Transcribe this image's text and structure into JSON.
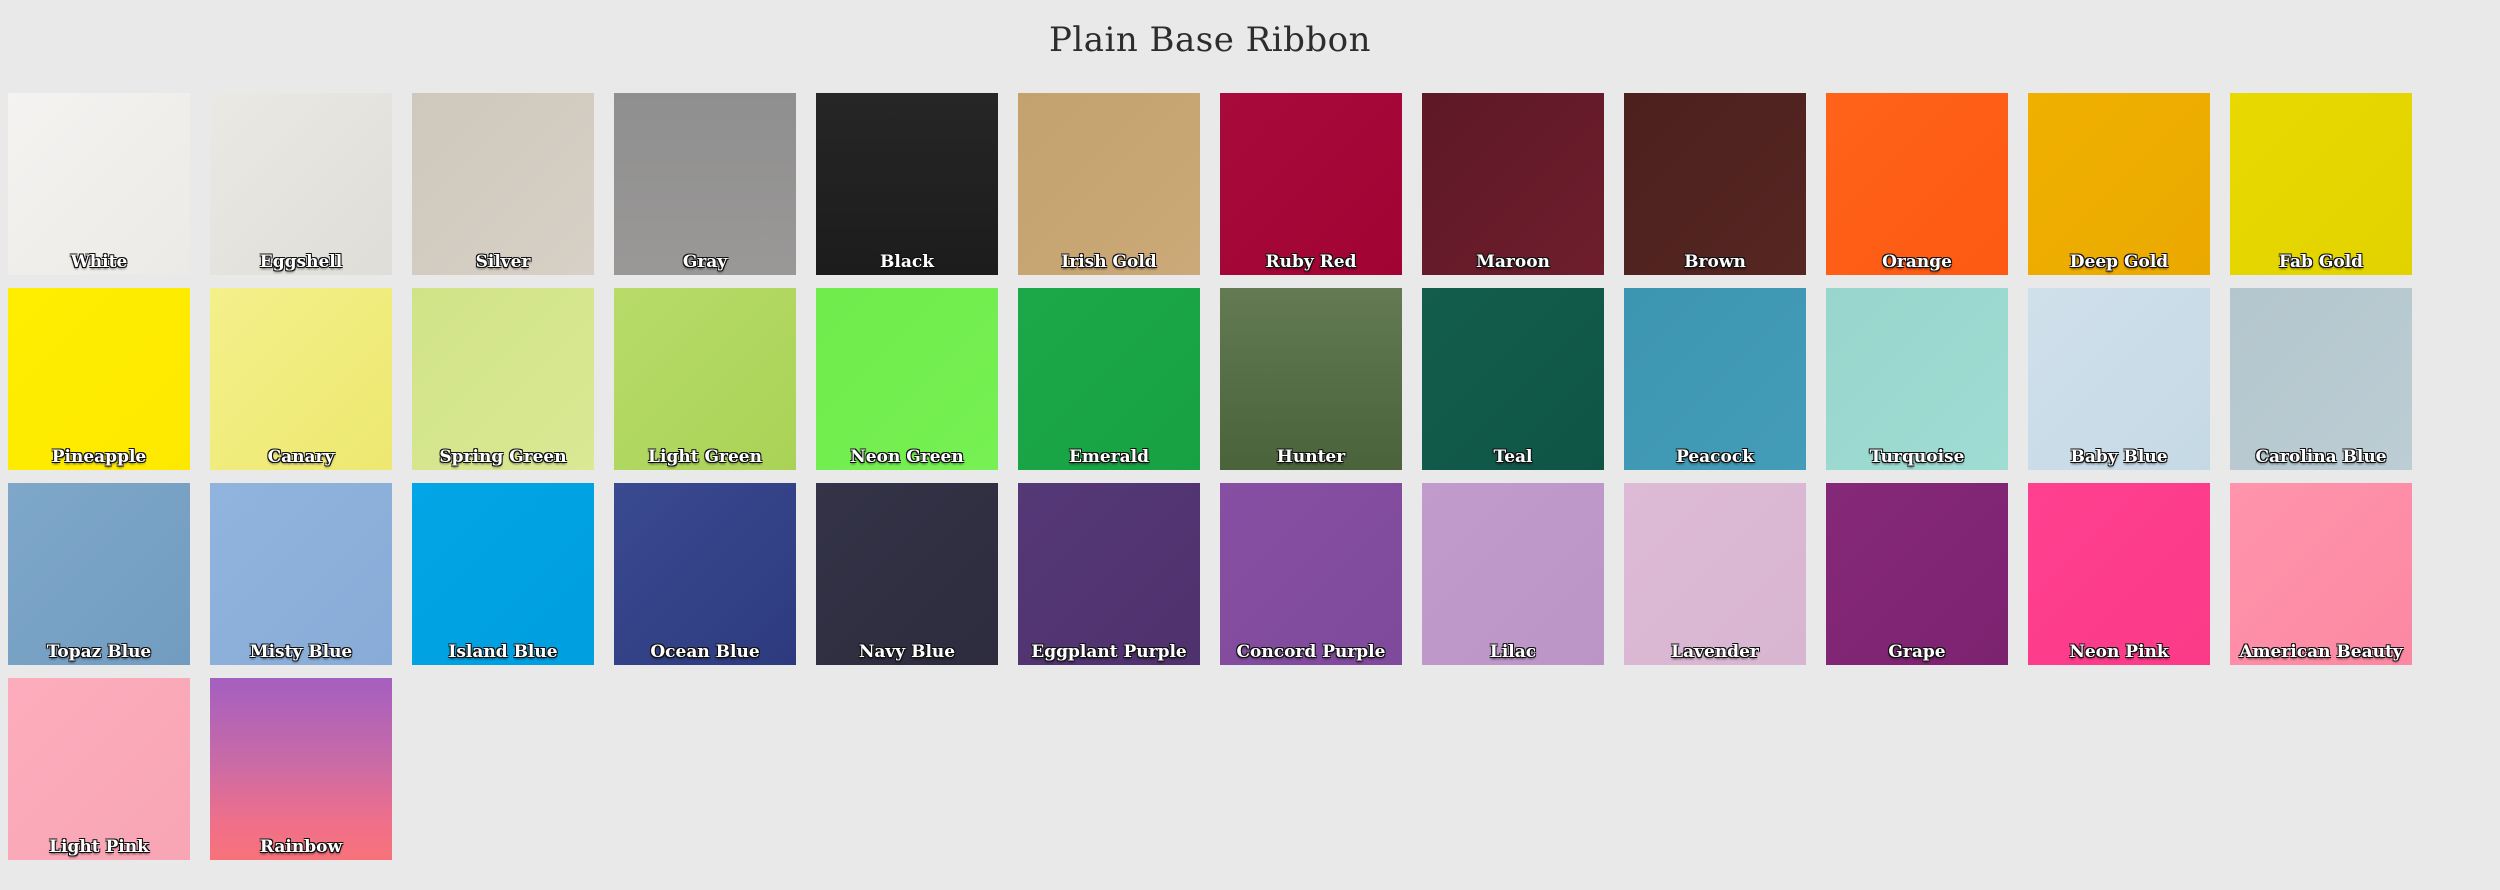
{
  "page": {
    "title": "Plain Base Ribbon"
  },
  "swatches": [
    {
      "label": "White",
      "color": "#f0efec",
      "gradient": "linear-gradient(135deg, #f4f3f1 0%, #eceae6 100%)"
    },
    {
      "label": "Eggshell",
      "color": "#e6e4df",
      "gradient": "linear-gradient(135deg, #ebe9e4 0%, #dfddd7 100%)"
    },
    {
      "label": "Silver",
      "color": "#d2cbbf",
      "gradient": "linear-gradient(135deg, #cfc8bc 0%, #d6d0c6 100%)"
    },
    {
      "label": "Gray",
      "color": "#959494",
      "gradient": "linear-gradient(180deg, #8f8f8f 0%, #9a9897 100%)"
    },
    {
      "label": "Black",
      "color": "#222222",
      "gradient": "linear-gradient(180deg, #262626 0%, #1c1c1c 100%)"
    },
    {
      "label": "Irish Gold",
      "color": "#c7a673",
      "gradient": "linear-gradient(135deg, #c4a26e 0%, #cba978 100%)"
    },
    {
      "label": "Ruby Red",
      "color": "#a70638",
      "gradient": "linear-gradient(135deg, #a80a3c 0%, #a10333 100%)"
    },
    {
      "label": "Maroon",
      "color": "#681c2a",
      "gradient": "linear-gradient(135deg, #5e1826 0%, #6e1e2d 100%)"
    },
    {
      "label": "Brown",
      "color": "#512220",
      "gradient": "linear-gradient(135deg, #4c201e 0%, #562622 100%)"
    },
    {
      "label": "Orange",
      "color": "#ff5e16",
      "gradient": "linear-gradient(135deg, #ff6318 0%, #fd5914 100%)"
    },
    {
      "label": "Deep Gold",
      "color": "#eeae00",
      "gradient": "linear-gradient(135deg, #f0b000 0%, #eba900 100%)"
    },
    {
      "label": "Fab Gold",
      "color": "#e5d700",
      "gradient": "linear-gradient(135deg, #e8d900 0%, #e2d300 100%)"
    },
    {
      "label": "Pineapple",
      "color": "#ffec00",
      "gradient": "linear-gradient(135deg, #ffee00 0%, #fde900 100%)"
    },
    {
      "label": "Canary",
      "color": "#f2ee7c",
      "gradient": "linear-gradient(135deg, #f4f08a 0%, #ede870 100%)"
    },
    {
      "label": "Spring Green",
      "color": "#d5e68c",
      "gradient": "linear-gradient(135deg, #d1e387 0%, #d9e994 100%)"
    },
    {
      "label": "Light Green",
      "color": "#b1d85f",
      "gradient": "linear-gradient(135deg, #b8db69 0%, #a9d356 100%)"
    },
    {
      "label": "Neon Green",
      "color": "#72ee4f",
      "gradient": "linear-gradient(135deg, #70ec4d 0%, #76f052 100%)"
    },
    {
      "label": "Emerald",
      "color": "#1aa546",
      "gradient": "linear-gradient(135deg, #1ca848 0%, #17a143 100%)"
    },
    {
      "label": "Hunter",
      "color": "#566f45",
      "gradient": "linear-gradient(180deg, #637a53 0%, #4a633b 100%)"
    },
    {
      "label": "Teal",
      "color": "#11594a",
      "gradient": "linear-gradient(135deg, #135d4c 0%, #0f5546 100%)"
    },
    {
      "label": "Peacock",
      "color": "#3f98b4",
      "gradient": "linear-gradient(135deg, #3c95b1 0%, #439cb8 100%)"
    },
    {
      "label": "Turquoise",
      "color": "#9ad8cf",
      "gradient": "linear-gradient(135deg, #98d6cd 0%, #9fdcd3 100%)"
    },
    {
      "label": "Baby Blue",
      "color": "#cbdde8",
      "gradient": "linear-gradient(135deg, #d0e0eb 0%, #c5d9e5 100%)"
    },
    {
      "label": "Carolina Blue",
      "color": "#b7c8cf",
      "gradient": "linear-gradient(135deg, #b4c6cd 0%, #bccdd4 100%)"
    },
    {
      "label": "Topaz Blue",
      "color": "#7ba4c6",
      "gradient": "linear-gradient(135deg, #7ea7c9 0%, #729cc0 100%)"
    },
    {
      "label": "Misty Blue",
      "color": "#8db1db",
      "gradient": "linear-gradient(135deg, #90b4dd 0%, #88acd7 100%)"
    },
    {
      "label": "Island Blue",
      "color": "#00a2e2",
      "gradient": "linear-gradient(135deg, #02a5e5 0%, #009fdf 100%)"
    },
    {
      "label": "Ocean Blue",
      "color": "#334187",
      "gradient": "linear-gradient(135deg, #3a4a91 0%, #2d3a7e 100%)"
    },
    {
      "label": "Navy Blue",
      "color": "#313043",
      "gradient": "linear-gradient(135deg, #343347 0%, #2d2c3e 100%)"
    },
    {
      "label": "Eggplant Purple",
      "color": "#523572",
      "gradient": "linear-gradient(135deg, #553877 0%, #4e316d 100%)"
    },
    {
      "label": "Concord Purple",
      "color": "#834d9f",
      "gradient": "linear-gradient(135deg, #874fa3 0%, #7f4a9b 100%)"
    },
    {
      "label": "Lilac",
      "color": "#bf99c9",
      "gradient": "linear-gradient(135deg, #c19bcb 0%, #bb95c6 100%)"
    },
    {
      "label": "Lavender",
      "color": "#dbb8d4",
      "gradient": "linear-gradient(135deg, #ddbad6 0%, #d8b5d1 100%)"
    },
    {
      "label": "Grape",
      "color": "#812674",
      "gradient": "linear-gradient(135deg, #852878 0%, #7c2370 100%)"
    },
    {
      "label": "Neon Pink",
      "color": "#ff3e8d",
      "gradient": "linear-gradient(135deg, #ff4090 0%, #fb3a88 100%)"
    },
    {
      "label": "American Beauty",
      "color": "#ff8ea8",
      "gradient": "linear-gradient(135deg, #ff94ac 0%, #fc88a2 100%)"
    },
    {
      "label": "Light Pink",
      "color": "#fbaab9",
      "gradient": "linear-gradient(135deg, #fcadbc 0%, #f8a5b5 100%)"
    },
    {
      "label": "Rainbow",
      "color": "#d06fa0",
      "gradient": "linear-gradient(180deg, #a45fc0 0%, #c86aa7 45%, #f0708a 80%, #f7727a 100%)"
    }
  ]
}
